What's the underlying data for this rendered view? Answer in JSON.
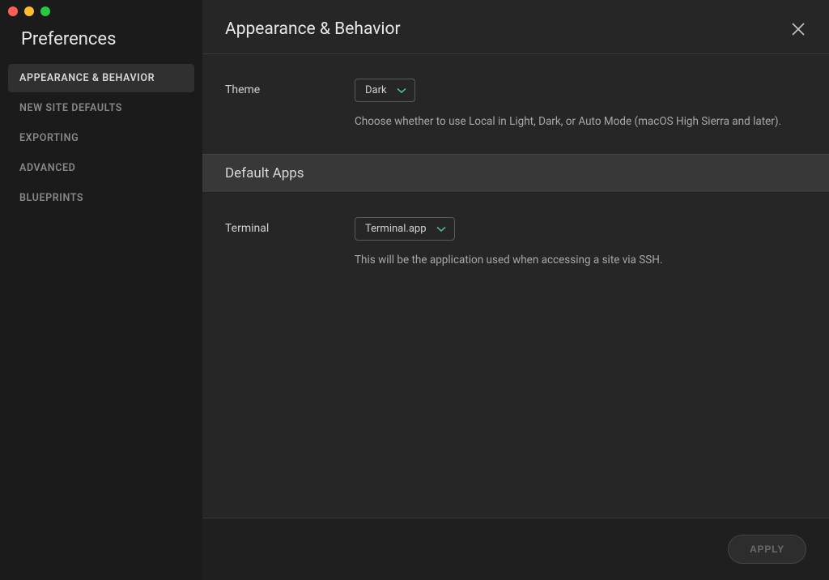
{
  "sidebar": {
    "title": "Preferences",
    "items": [
      {
        "label": "Appearance & Behavior",
        "active": true
      },
      {
        "label": "New Site Defaults",
        "active": false
      },
      {
        "label": "Exporting",
        "active": false
      },
      {
        "label": "Advanced",
        "active": false
      },
      {
        "label": "Blueprints",
        "active": false
      }
    ]
  },
  "header": {
    "title": "Appearance & Behavior"
  },
  "settings": {
    "theme": {
      "label": "Theme",
      "value": "Dark",
      "description": "Choose whether to use Local in Light, Dark, or Auto Mode (macOS High Sierra and later)."
    },
    "section_default_apps": "Default Apps",
    "terminal": {
      "label": "Terminal",
      "value": "Terminal.app",
      "description": "This will be the application used when accessing a site via SSH."
    }
  },
  "footer": {
    "apply_label": "Apply"
  }
}
